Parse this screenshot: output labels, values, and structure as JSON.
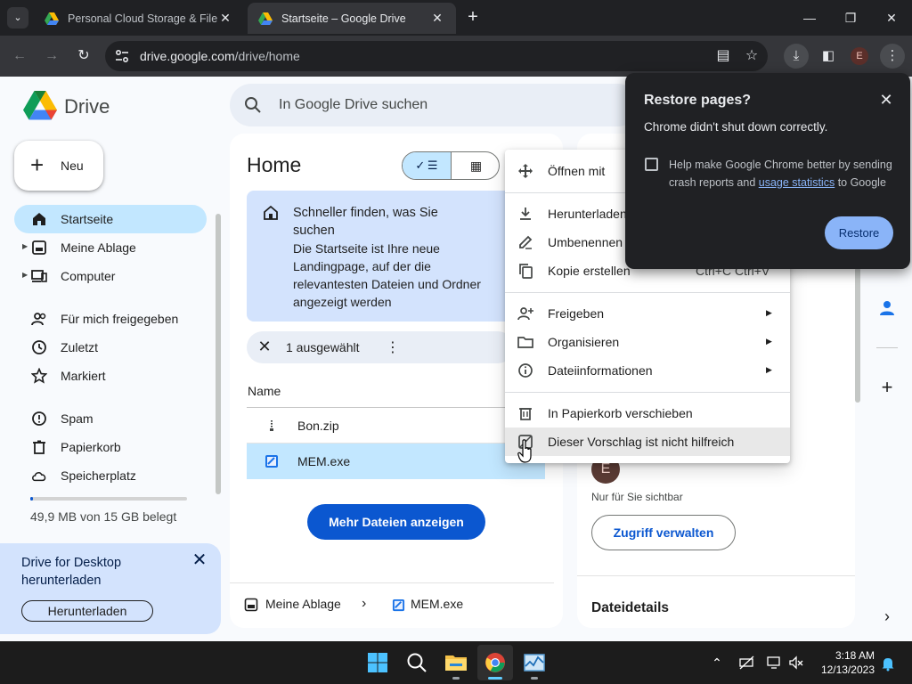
{
  "browser": {
    "tabs": [
      {
        "title": "Personal Cloud Storage & File S",
        "active": false
      },
      {
        "title": "Startseite – Google Drive",
        "active": true
      }
    ],
    "url_host": "drive.google.com",
    "url_path": "/drive/home",
    "profile_initial": "E"
  },
  "drive": {
    "brand": "Drive",
    "search_placeholder": "In Google Drive suchen",
    "new_label": "Neu",
    "nav": [
      {
        "label": "Startseite",
        "icon": "home-icon",
        "active": true
      },
      {
        "label": "Meine Ablage",
        "icon": "drive-folder-icon",
        "caret": true
      },
      {
        "label": "Computer",
        "icon": "computer-icon",
        "caret": true
      },
      {
        "label": "Für mich freigegeben",
        "icon": "shared-icon"
      },
      {
        "label": "Zuletzt",
        "icon": "clock-icon"
      },
      {
        "label": "Markiert",
        "icon": "star-icon"
      },
      {
        "label": "Spam",
        "icon": "spam-icon"
      },
      {
        "label": "Papierkorb",
        "icon": "trash-icon"
      },
      {
        "label": "Speicherplatz",
        "icon": "cloud-icon"
      }
    ],
    "storage_text": "49,9 MB von 15 GB belegt",
    "storage_fraction": 0.0033,
    "promo": {
      "text": "Drive for Desktop herunterladen",
      "button": "Herunterladen"
    }
  },
  "main": {
    "title": "Home",
    "info_title": "Schneller finden, was Sie suchen",
    "info_body": "Die Startseite ist Ihre neue Landingpage, auf der die relevantesten Dateien und Ordner angezeigt werden",
    "selection_text": "1 ausgewählt",
    "column_name": "Name",
    "files": [
      {
        "name": "Bon.zip",
        "icon": "zip-icon",
        "selected": false
      },
      {
        "name": "MEM.exe",
        "icon": "exe-icon",
        "selected": true
      }
    ],
    "more_files_label": "Mehr Dateien anzeigen",
    "breadcrumb": [
      "Meine Ablage",
      "MEM.exe"
    ]
  },
  "context_menu": {
    "items": [
      {
        "label": "Öffnen mit",
        "icon": "open-with-icon",
        "shortcut": "",
        "submenu": false
      },
      {
        "label": "Herunterladen",
        "icon": "download-icon",
        "shortcut": "",
        "submenu": false
      },
      {
        "label": "Umbenennen",
        "icon": "rename-icon",
        "shortcut": "",
        "submenu": false
      },
      {
        "label": "Kopie erstellen",
        "icon": "copy-icon",
        "shortcut": "Ctrl+C Ctrl+V",
        "submenu": false
      },
      {
        "label": "Freigeben",
        "icon": "share-icon",
        "shortcut": "",
        "submenu": true
      },
      {
        "label": "Organisieren",
        "icon": "folder-icon",
        "shortcut": "",
        "submenu": true
      },
      {
        "label": "Dateiinformationen",
        "icon": "info-icon",
        "shortcut": "",
        "submenu": true
      },
      {
        "label": "In Papierkorb verschieben",
        "icon": "trash-icon",
        "shortcut": "",
        "submenu": false
      },
      {
        "label": "Dieser Vorschlag ist nicht hilfreich",
        "icon": "not-helpful-icon",
        "shortcut": "",
        "submenu": false
      }
    ]
  },
  "details": {
    "owner_initial": "E",
    "visibility": "Nur für Sie sichtbar",
    "manage_access": "Zugriff verwalten",
    "section_title": "Dateidetails"
  },
  "restore_dialog": {
    "title": "Restore pages?",
    "message": "Chrome didn't shut down correctly.",
    "checkbox_text_before": "Help make Google Chrome better by sending crash reports and ",
    "checkbox_link": "usage statistics",
    "checkbox_text_after": " to Google",
    "button": "Restore"
  },
  "taskbar": {
    "time": "3:18 AM",
    "date": "12/13/2023"
  },
  "colors": {
    "accent": "#0b57d0",
    "selection": "#c2e7ff",
    "info_card": "#d3e3fd",
    "chrome_dark": "#202124",
    "restore_button": "#8ab4f8"
  }
}
